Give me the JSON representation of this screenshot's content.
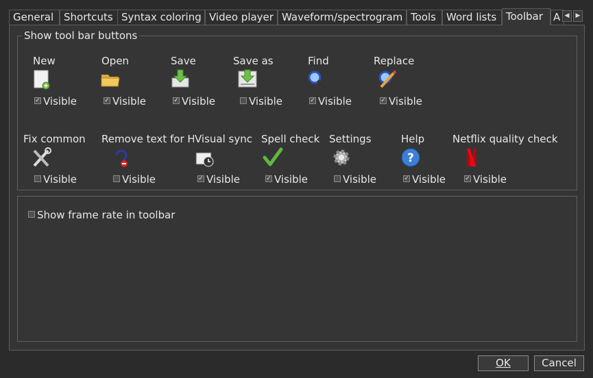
{
  "tabs": [
    {
      "label": "General"
    },
    {
      "label": "Shortcuts"
    },
    {
      "label": "Syntax coloring"
    },
    {
      "label": "Video player"
    },
    {
      "label": "Waveform/spectrogram"
    },
    {
      "label": "Tools"
    },
    {
      "label": "Word lists"
    },
    {
      "label": "Toolbar",
      "active": true
    },
    {
      "label": "A"
    }
  ],
  "toolbar_group": {
    "title": "Show tool bar buttons",
    "buttons": [
      {
        "label": "New",
        "icon": "new-file-icon",
        "visible_label": "Visible",
        "checked": true
      },
      {
        "label": "Open",
        "icon": "folder-icon",
        "visible_label": "Visible",
        "checked": true
      },
      {
        "label": "Save",
        "icon": "save-icon",
        "visible_label": "Visible",
        "checked": true
      },
      {
        "label": "Save as",
        "icon": "save-as-icon",
        "visible_label": "Visible",
        "checked": false
      },
      {
        "label": "Find",
        "icon": "magnifier-icon",
        "visible_label": "Visible",
        "checked": true
      },
      {
        "label": "Replace",
        "icon": "replace-icon",
        "visible_label": "Visible",
        "checked": true
      },
      {
        "label": "Fix common",
        "icon": "tools-icon",
        "visible_label": "Visible",
        "checked": false
      },
      {
        "label": "Remove text for HI",
        "icon": "remove-hi-icon",
        "visible_label": "Visible",
        "checked": false
      },
      {
        "label": "Visual sync",
        "icon": "clapper-clock-icon",
        "visible_label": "Visible",
        "checked": true
      },
      {
        "label": "Spell check",
        "icon": "checkmark-icon",
        "visible_label": "Visible",
        "checked": true
      },
      {
        "label": "Settings",
        "icon": "gear-icon",
        "visible_label": "Visible",
        "checked": false
      },
      {
        "label": "Help",
        "icon": "help-icon",
        "visible_label": "Visible",
        "checked": true
      },
      {
        "label": "Netflix quality check",
        "icon": "netflix-icon",
        "visible_label": "Visible",
        "checked": true
      }
    ]
  },
  "frame_rate": {
    "label": "Show frame rate in toolbar",
    "checked": false
  },
  "dialog": {
    "ok_label": "OK",
    "cancel_label": "Cancel"
  },
  "colors": {
    "background": "#2b2b2b",
    "panel": "#353535",
    "border": "#606060",
    "text": "#e8e8e8"
  }
}
